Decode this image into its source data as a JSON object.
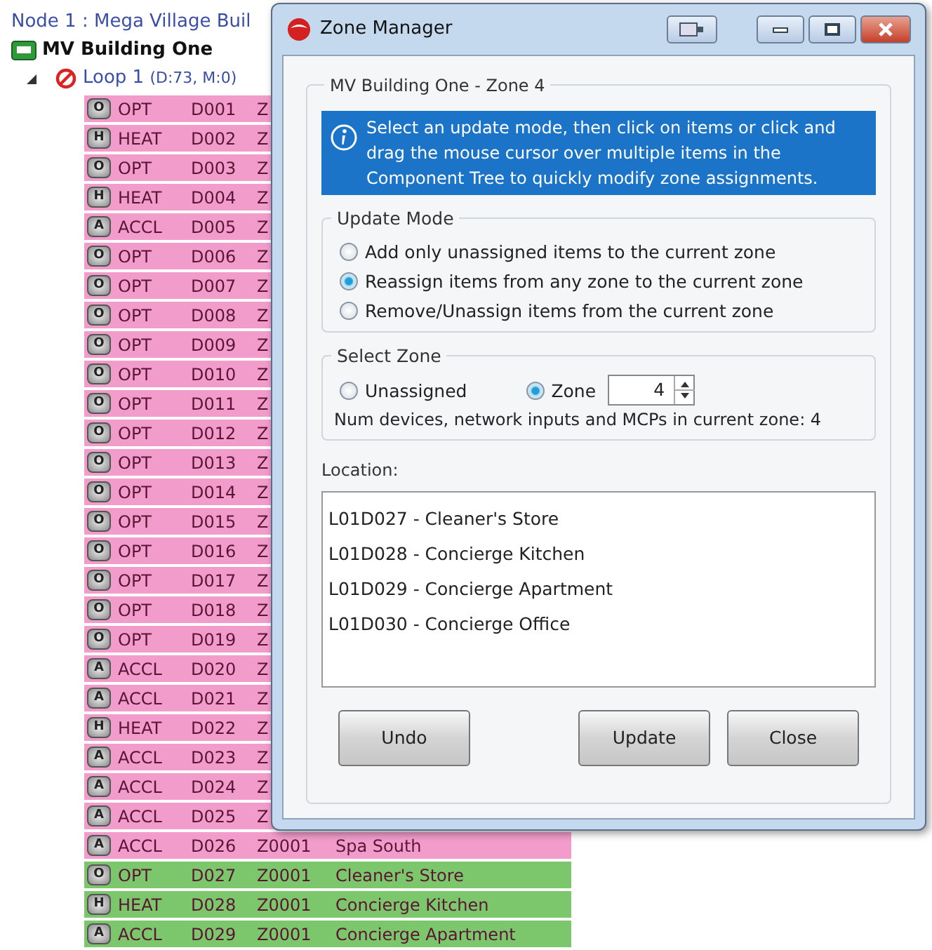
{
  "tree": {
    "node_label": "Node  1  : Mega Village Buil",
    "building": "MV Building One",
    "loop": {
      "label": "Loop 1",
      "counts": "(D:73, M:0)",
      "expanded": true
    },
    "rows": [
      {
        "badge": "O",
        "type": "OPT",
        "device": "D001",
        "zone": "Z",
        "color": "#f29ccb"
      },
      {
        "badge": "H",
        "type": "HEAT",
        "device": "D002",
        "zone": "Z",
        "color": "#f29ccb"
      },
      {
        "badge": "O",
        "type": "OPT",
        "device": "D003",
        "zone": "Z",
        "color": "#f29ccb"
      },
      {
        "badge": "H",
        "type": "HEAT",
        "device": "D004",
        "zone": "Z",
        "color": "#f29ccb"
      },
      {
        "badge": "A",
        "type": "ACCL",
        "device": "D005",
        "zone": "Z",
        "color": "#f29ccb"
      },
      {
        "badge": "O",
        "type": "OPT",
        "device": "D006",
        "zone": "Z",
        "color": "#f29ccb"
      },
      {
        "badge": "O",
        "type": "OPT",
        "device": "D007",
        "zone": "Z",
        "color": "#f29ccb"
      },
      {
        "badge": "O",
        "type": "OPT",
        "device": "D008",
        "zone": "Z",
        "color": "#f29ccb"
      },
      {
        "badge": "O",
        "type": "OPT",
        "device": "D009",
        "zone": "Z",
        "color": "#f29ccb"
      },
      {
        "badge": "O",
        "type": "OPT",
        "device": "D010",
        "zone": "Z",
        "color": "#f29ccb"
      },
      {
        "badge": "O",
        "type": "OPT",
        "device": "D011",
        "zone": "Z",
        "color": "#f29ccb"
      },
      {
        "badge": "O",
        "type": "OPT",
        "device": "D012",
        "zone": "Z",
        "color": "#f29ccb"
      },
      {
        "badge": "O",
        "type": "OPT",
        "device": "D013",
        "zone": "Z",
        "color": "#f29ccb"
      },
      {
        "badge": "O",
        "type": "OPT",
        "device": "D014",
        "zone": "Z",
        "color": "#f29ccb"
      },
      {
        "badge": "O",
        "type": "OPT",
        "device": "D015",
        "zone": "Z",
        "color": "#f29ccb"
      },
      {
        "badge": "O",
        "type": "OPT",
        "device": "D016",
        "zone": "Z",
        "color": "#f29ccb"
      },
      {
        "badge": "O",
        "type": "OPT",
        "device": "D017",
        "zone": "Z",
        "color": "#f29ccb"
      },
      {
        "badge": "O",
        "type": "OPT",
        "device": "D018",
        "zone": "Z",
        "color": "#f29ccb"
      },
      {
        "badge": "O",
        "type": "OPT",
        "device": "D019",
        "zone": "Z",
        "color": "#f29ccb"
      },
      {
        "badge": "A",
        "type": "ACCL",
        "device": "D020",
        "zone": "Z",
        "color": "#f29ccb"
      },
      {
        "badge": "A",
        "type": "ACCL",
        "device": "D021",
        "zone": "Z",
        "color": "#f29ccb"
      },
      {
        "badge": "H",
        "type": "HEAT",
        "device": "D022",
        "zone": "Z",
        "color": "#f29ccb"
      },
      {
        "badge": "A",
        "type": "ACCL",
        "device": "D023",
        "zone": "Z",
        "color": "#f29ccb"
      },
      {
        "badge": "A",
        "type": "ACCL",
        "device": "D024",
        "zone": "Z",
        "color": "#f29ccb"
      },
      {
        "badge": "A",
        "type": "ACCL",
        "device": "D025",
        "zone": "Z",
        "color": "#f29ccb"
      },
      {
        "badge": "A",
        "type": "ACCL",
        "device": "D026",
        "zone": "Z0001",
        "location": "Spa South",
        "color": "#f29ccb"
      },
      {
        "badge": "O",
        "type": "OPT",
        "device": "D027",
        "zone": "Z0001",
        "location": "Cleaner's Store",
        "color": "#7cc76c"
      },
      {
        "badge": "H",
        "type": "HEAT",
        "device": "D028",
        "zone": "Z0001",
        "location": "Concierge Kitchen",
        "color": "#7cc76c"
      },
      {
        "badge": "A",
        "type": "ACCL",
        "device": "D029",
        "zone": "Z0001",
        "location": "Concierge Apartment",
        "color": "#7cc76c"
      }
    ]
  },
  "dialog": {
    "title": "Zone Manager",
    "group_title": "MV Building One - Zone 4",
    "info": "Select an update mode, then click on items or click and drag the mouse cursor over multiple items in the Component Tree to quickly modify zone assignments.",
    "update_mode": {
      "title": "Update Mode",
      "options": [
        {
          "label": "Add only unassigned items to the current zone",
          "selected": false
        },
        {
          "label": "Reassign items from any zone to the current zone",
          "selected": true
        },
        {
          "label": "Remove/Unassign items from the current zone",
          "selected": false
        }
      ]
    },
    "select_zone": {
      "title": "Select Zone",
      "options": [
        {
          "label": "Unassigned",
          "selected": false
        },
        {
          "label": "Zone",
          "selected": true
        }
      ],
      "zone_value": "4",
      "count_text": "Num devices, network inputs and MCPs in current zone: 4"
    },
    "location_label": "Location:",
    "locations": [
      "L01D027 - Cleaner's Store",
      "L01D028 - Concierge Kitchen",
      "L01D029 - Concierge Apartment",
      "L01D030 - Concierge Office"
    ],
    "buttons": [
      "Undo",
      "Update",
      "Close"
    ]
  }
}
